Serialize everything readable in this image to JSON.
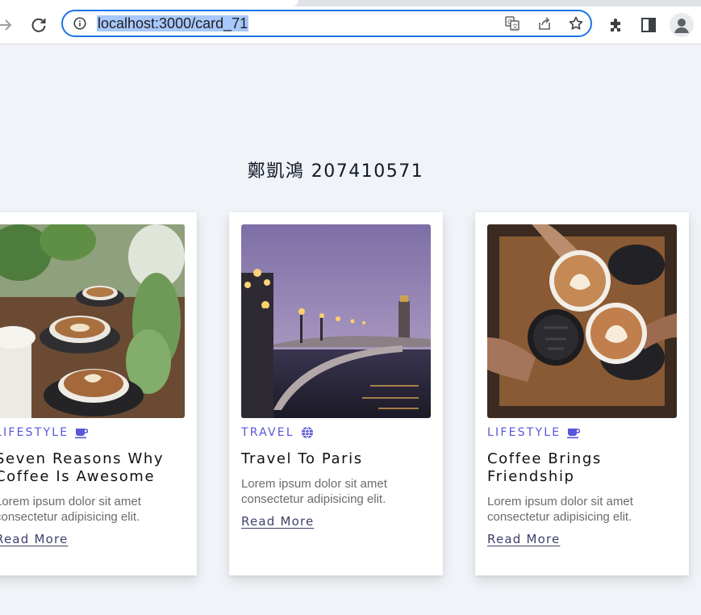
{
  "browser": {
    "url": "localhost:3000/card_71",
    "icons": {
      "forward": "arrow-right-icon",
      "reload": "reload-icon",
      "info": "info-icon",
      "translate": "translate-icon",
      "share": "share-icon",
      "bookmark": "star-icon",
      "extensions": "puzzle-icon",
      "side_panel": "side-panel-icon",
      "profile": "profile-icon"
    }
  },
  "page": {
    "heading": "鄭凱鴻 207410571",
    "accent_color": "#5a56d8"
  },
  "cards": [
    {
      "category": "LIFESTYLE",
      "category_icon": "coffee-cup-icon",
      "title": "Seven Reasons Why Coffee Is Awesome",
      "description": "Lorem ipsum dolor sit amet consectetur adipisicing elit.",
      "link": "Read More"
    },
    {
      "category": "TRAVEL",
      "category_icon": "globe-icon",
      "title": "Travel To Paris",
      "description": "Lorem ipsum dolor sit amet consectetur adipisicing elit.",
      "link": "Read More"
    },
    {
      "category": "LIFESTYLE",
      "category_icon": "coffee-cup-icon",
      "title": "Coffee Brings Friendship",
      "description": "Lorem ipsum dolor sit amet consectetur adipisicing elit.",
      "link": "Read More"
    }
  ]
}
